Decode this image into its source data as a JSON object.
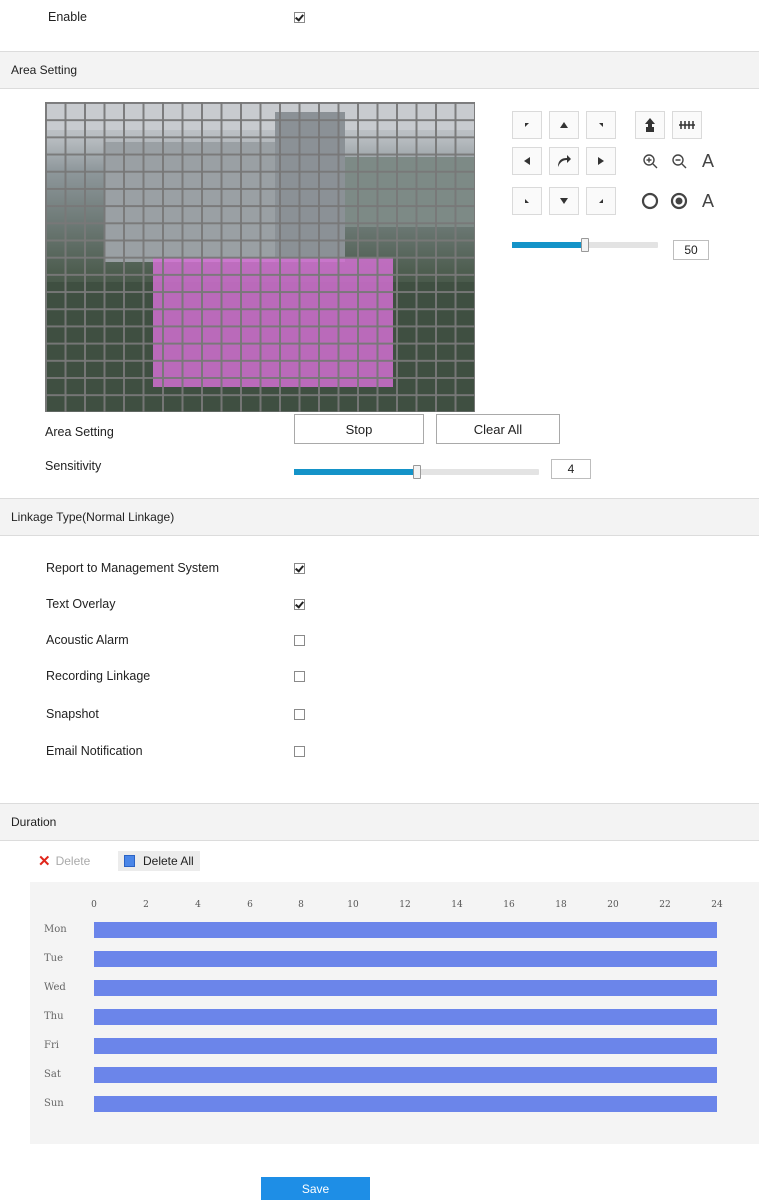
{
  "enable": {
    "label": "Enable",
    "checked": true
  },
  "area_setting_section": {
    "title": "Area Setting"
  },
  "ptz": {
    "icons": [
      "arrow-up-left-icon",
      "arrow-up-icon",
      "arrow-up-right-icon",
      "arrow-left-icon",
      "auto-rotate-icon",
      "arrow-right-icon",
      "arrow-down-left-icon",
      "arrow-down-icon",
      "arrow-down-right-icon",
      "wiper-icon",
      "light-icon",
      "zoom-in-icon",
      "zoom-out-icon",
      "focus-icon",
      "iris-open-icon",
      "iris-close-icon",
      "iris-auto-icon"
    ],
    "focus_letter": "A",
    "iris_letter": "A",
    "speed_value": "50",
    "speed_fraction": 0.5
  },
  "area_controls": {
    "area_label": "Area Setting",
    "stop_label": "Stop",
    "clear_all_label": "Clear All",
    "sensitivity_label": "Sensitivity",
    "sensitivity_value": "4",
    "sensitivity_fraction": 0.5
  },
  "linkage_section": {
    "title": "Linkage Type(Normal Linkage)"
  },
  "linkage_items": [
    {
      "label": "Report to Management System",
      "checked": true
    },
    {
      "label": "Text Overlay",
      "checked": true
    },
    {
      "label": "Acoustic Alarm",
      "checked": false
    },
    {
      "label": "Recording Linkage",
      "checked": false
    },
    {
      "label": "Snapshot",
      "checked": false
    },
    {
      "label": "Email Notification",
      "checked": false
    }
  ],
  "duration_section": {
    "title": "Duration"
  },
  "duration_toolbar": {
    "delete_label": "Delete",
    "delete_all_label": "Delete All"
  },
  "schedule": {
    "hours": [
      "0",
      "2",
      "4",
      "6",
      "8",
      "10",
      "12",
      "14",
      "16",
      "18",
      "20",
      "22",
      "24"
    ],
    "days": [
      "Mon",
      "Tue",
      "Wed",
      "Thu",
      "Fri",
      "Sat",
      "Sun"
    ],
    "bar_color": "#6b85ea"
  },
  "save_label": "Save",
  "colors": {
    "accent": "#1e8ee6",
    "slider": "#1493c8",
    "motion_area": "#d670d6"
  }
}
